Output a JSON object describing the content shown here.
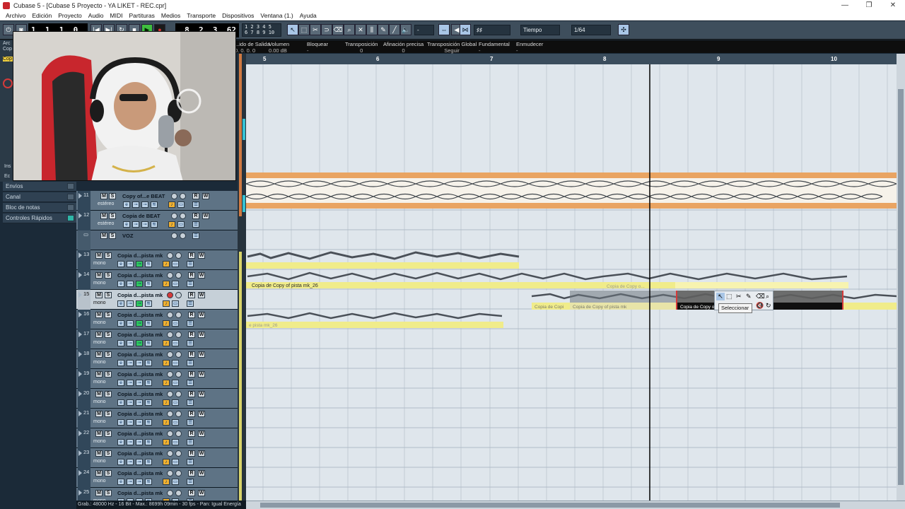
{
  "window": {
    "title": "Cubase 5 - [Cubase 5 Proyecto - YA LIKET - REC.cpr]"
  },
  "menu": [
    "Archivo",
    "Edición",
    "Proyecto",
    "Audio",
    "MIDI",
    "Partituras",
    "Medios",
    "Transporte",
    "Dispositivos",
    "Ventana (1.)",
    "Ayuda"
  ],
  "toolbar": {
    "left_locator": "1. 1. 1. 0",
    "position": "8. 2. 3. 62",
    "snap_mode": "Tiempo",
    "quantize": "1/64"
  },
  "infoline": [
    {
      "label": "...ido de Salida",
      "value": "0. 0. 0. 0"
    },
    {
      "label": "Volumen",
      "value": "0.00 dB"
    },
    {
      "label": "Bloquear",
      "value": "-"
    },
    {
      "label": "Transposición",
      "value": "0"
    },
    {
      "label": "Afinación precisa",
      "value": "0"
    },
    {
      "label": "Transposición Global",
      "value": "Seguir"
    },
    {
      "label": "Fundamental",
      "value": "-"
    },
    {
      "label": "Enmudecer",
      "value": "-"
    }
  ],
  "inspector": {
    "truncated": [
      "Arc",
      "Cop",
      "Cop",
      "Ins",
      "Ec"
    ],
    "sections": [
      "Envíos",
      "Canal",
      "Bloc de notas",
      "Controles Rápidos"
    ]
  },
  "tracks": [
    {
      "number": "11",
      "name": "Copy of...e BEAT",
      "sub": "estéreo",
      "kind": "audio"
    },
    {
      "number": "12",
      "name": "Copia de BEAT",
      "sub": "estéreo",
      "kind": "audio"
    },
    {
      "number": "",
      "name": "VOZ",
      "sub": "",
      "kind": "folder"
    },
    {
      "number": "13",
      "name": "Copia d...pista mk",
      "sub": "mono",
      "kind": "audio"
    },
    {
      "number": "14",
      "name": "Copia d...pista mk",
      "sub": "mono",
      "kind": "audio"
    },
    {
      "number": "15",
      "name": "Copia d...pista mk",
      "sub": "mono",
      "kind": "selected"
    },
    {
      "number": "16",
      "name": "Copia d...pista mk",
      "sub": "mono",
      "kind": "audio"
    },
    {
      "number": "17",
      "name": "Copia d...pista mk",
      "sub": "mono",
      "kind": "audio"
    },
    {
      "number": "18",
      "name": "Copia d...pista mk",
      "sub": "mono",
      "kind": "audio"
    },
    {
      "number": "19",
      "name": "Copia d...pista mk",
      "sub": "mono",
      "kind": "audio"
    },
    {
      "number": "20",
      "name": "Copia d...pista mk",
      "sub": "mono",
      "kind": "audio"
    },
    {
      "number": "21",
      "name": "Copia d...pista mk",
      "sub": "mono",
      "kind": "audio"
    },
    {
      "number": "22",
      "name": "Copia d...pista mk",
      "sub": "mono",
      "kind": "audio"
    },
    {
      "number": "23",
      "name": "Copia d...pista mk",
      "sub": "mono",
      "kind": "audio"
    },
    {
      "number": "24",
      "name": "Copia d...pista mk",
      "sub": "mono",
      "kind": "audio"
    },
    {
      "number": "25",
      "name": "Copia d...pista mk",
      "sub": "mono",
      "kind": "audio"
    }
  ],
  "track_button_labels": {
    "mute": "M",
    "solo": "S",
    "read": "R",
    "write": "W",
    "edit": "e"
  },
  "ruler": [
    "5",
    "6",
    "7",
    "8",
    "9",
    "10"
  ],
  "events": {
    "track14_label": "Copia de Copy of pista mk_26",
    "track15_labels": [
      "Copia de Copi",
      "Copia de Copy of pista mk",
      "Copia de Copy o...",
      "Copia de Copy of pist"
    ],
    "track16_label": "e pista mk_26"
  },
  "tooltip": "Seleccionar",
  "statusbar": "Grab.: 48000 Hz - 16 Bit - Max.: 8699h 09min - 30 fps - Pan: Igual Energía",
  "colors": {
    "background": "#1b2a38",
    "track": "#5e7385",
    "event_yellow": "#f0ec8a",
    "beat_orange": "#e9a462"
  }
}
